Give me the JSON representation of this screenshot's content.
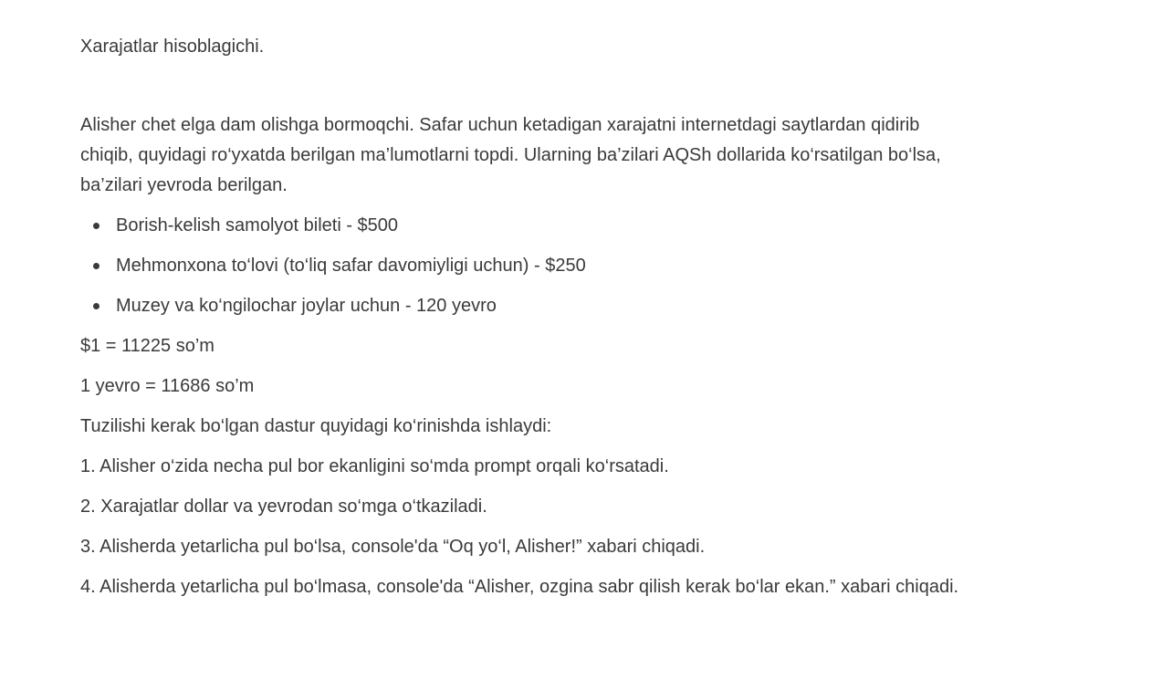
{
  "document": {
    "title": "Xarajatlar hisoblagichi.",
    "intro": "Alisher chet elga dam olishga bormoqchi. Safar uchun ketadigan xarajatni internetdagi saytlardan qidirib chiqib, quyidagi ro‘yxatda berilgan ma’lumotlarni topdi. Ularning ba’zilari AQSh dollarida ko‘rsatilgan bo‘lsa, ba’zilari yevroda berilgan.",
    "costs": [
      "Borish-kelish samolyot bileti - $500",
      "Mehmonxona to‘lovi (to‘liq safar davomiyligi uchun) - $250",
      "Muzey va ko‘ngilochar joylar uchun - 120 yevro"
    ],
    "rate_usd": "$1 = 11225 so’m",
    "rate_eur": "1 yevro = 11686 so’m",
    "program_intro": "Tuzilishi kerak bo‘lgan dastur quyidagi ko‘rinishda ishlaydi:",
    "steps": [
      "1. Alisher o‘zida necha pul bor ekanligini so‘mda prompt orqali ko‘rsatadi.",
      "2. Xarajatlar dollar va yevrodan so‘mga o‘tkaziladi.",
      "3. Alisherda yetarlicha pul bo‘lsa, console'da  “Oq yo‘l, Alisher!” xabari chiqadi.",
      "4. Alisherda yetarlicha pul bo‘lmasa, console'da “Alisher, ozgina sabr qilish kerak bo‘lar ekan.” xabari chiqadi."
    ]
  }
}
